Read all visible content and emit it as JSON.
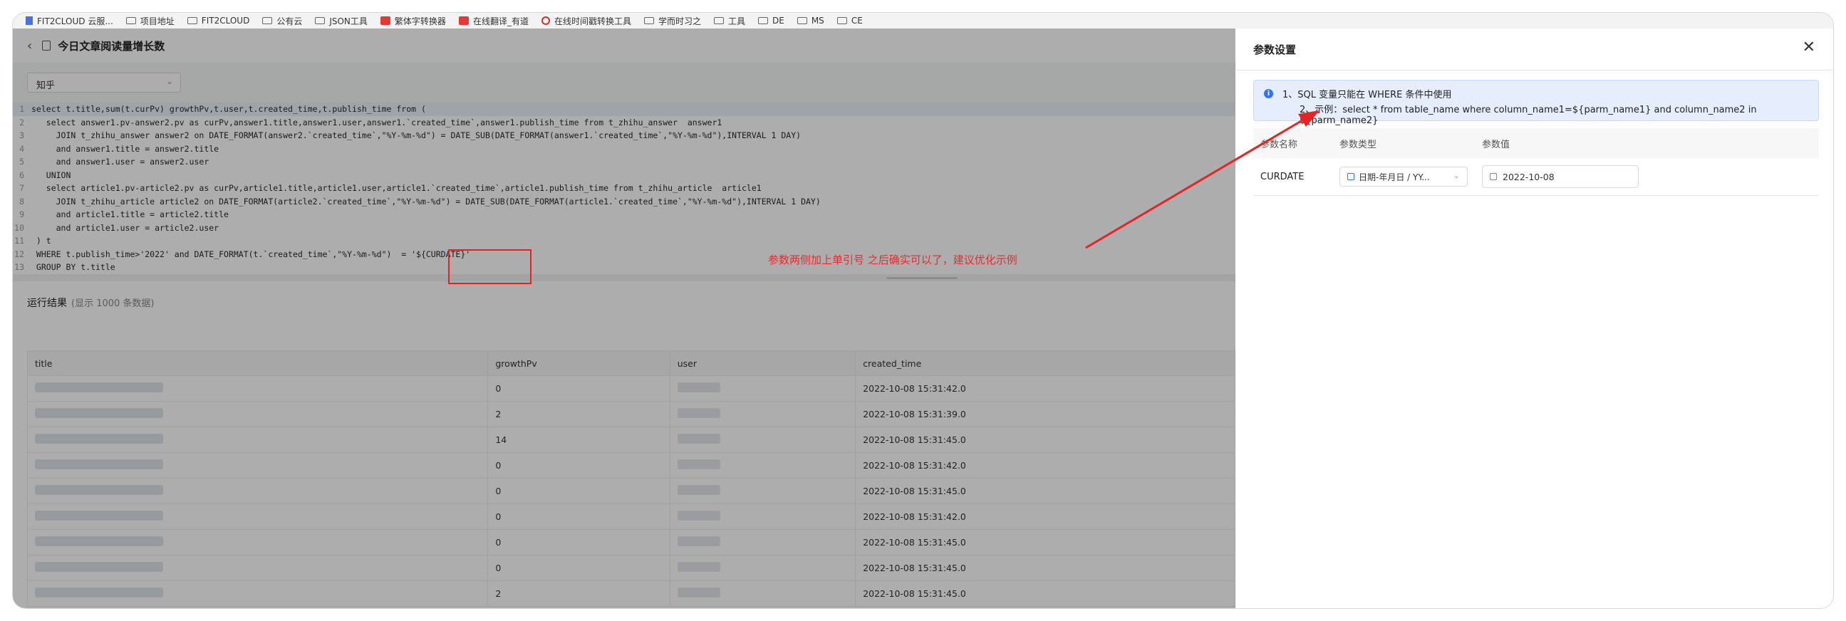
{
  "bookmarks": [
    "FIT2CLOUD 云服...",
    "项目地址",
    "FIT2CLOUD",
    "公有云",
    "JSON工具",
    "繁体字转换器",
    "在线翻译_有道",
    "在线时间戳转换工具",
    "学而时习之",
    "工具",
    "DE",
    "MS",
    "CE"
  ],
  "page": {
    "title": "今日文章阅读量增长数",
    "back_icon": "chevron-left-icon",
    "datasource": "知乎"
  },
  "sql_lines": [
    {
      "n": "1",
      "t": "select t.title,sum(t.curPv) growthPv,t.user,t.created_time,t.publish_time from ("
    },
    {
      "n": "2",
      "t": "   select answer1.pv-answer2.pv as curPv,answer1.title,answer1.user,answer1.`created_time`,answer1.publish_time from t_zhihu_answer  answer1"
    },
    {
      "n": "3",
      "t": "     JOIN t_zhihu_answer answer2 on DATE_FORMAT(answer2.`created_time`,\"%Y-%m-%d\") = DATE_SUB(DATE_FORMAT(answer1.`created_time`,\"%Y-%m-%d\"),INTERVAL 1 DAY)"
    },
    {
      "n": "4",
      "t": "     and answer1.title = answer2.title"
    },
    {
      "n": "5",
      "t": "     and answer1.user = answer2.user"
    },
    {
      "n": "6",
      "t": "   UNION"
    },
    {
      "n": "7",
      "t": "   select article1.pv-article2.pv as curPv,article1.title,article1.user,article1.`created_time`,article1.publish_time from t_zhihu_article  article1"
    },
    {
      "n": "8",
      "t": "     JOIN t_zhihu_article article2 on DATE_FORMAT(article2.`created_time`,\"%Y-%m-%d\") = DATE_SUB(DATE_FORMAT(article1.`created_time`,\"%Y-%m-%d\"),INTERVAL 1 DAY)"
    },
    {
      "n": "9",
      "t": "     and article1.title = article2.title"
    },
    {
      "n": "10",
      "t": "     and article1.user = article2.user"
    },
    {
      "n": "11",
      "t": " ) t"
    },
    {
      "n": "12",
      "t": " WHERE t.publish_time>'2022' and DATE_FORMAT(t.`created_time`,\"%Y-%m-%d\")  = '${CURDATE}'"
    },
    {
      "n": "13",
      "t": " GROUP BY t.title"
    }
  ],
  "result": {
    "title": "运行结果",
    "subtitle": "(显示 1000 条数据)",
    "columns": [
      "title",
      "growthPv",
      "user",
      "created_time"
    ],
    "rows": [
      {
        "growthPv": "0",
        "created_time": "2022-10-08 15:31:42.0"
      },
      {
        "growthPv": "2",
        "created_time": "2022-10-08 15:31:39.0"
      },
      {
        "growthPv": "14",
        "created_time": "2022-10-08 15:31:45.0"
      },
      {
        "growthPv": "0",
        "created_time": "2022-10-08 15:31:42.0"
      },
      {
        "growthPv": "0",
        "created_time": "2022-10-08 15:31:45.0"
      },
      {
        "growthPv": "0",
        "created_time": "2022-10-08 15:31:42.0"
      },
      {
        "growthPv": "0",
        "created_time": "2022-10-08 15:31:45.0"
      },
      {
        "growthPv": "0",
        "created_time": "2022-10-08 15:31:45.0"
      },
      {
        "growthPv": "2",
        "created_time": "2022-10-08 15:31:45.0"
      }
    ]
  },
  "annotation": {
    "text": "参数两侧加上单引号 之后确实可以了，建议优化示例",
    "color": "#ea2a2a"
  },
  "drawer": {
    "title": "参数设置",
    "info_line1": "1、SQL 变量只能在 WHERE 条件中使用",
    "info_line2": "2、示例：select * from table_name where column_name1=${parm_name1} and column_name2 in ${parm_name2}",
    "headers": [
      "参数名称",
      "参数类型",
      "参数值"
    ],
    "param": {
      "name": "CURDATE",
      "type": "日期-年月日 / YY...",
      "value": "2022-10-08"
    }
  },
  "colors": {
    "accent": "#3370ff",
    "annotation_red": "#e52222"
  }
}
